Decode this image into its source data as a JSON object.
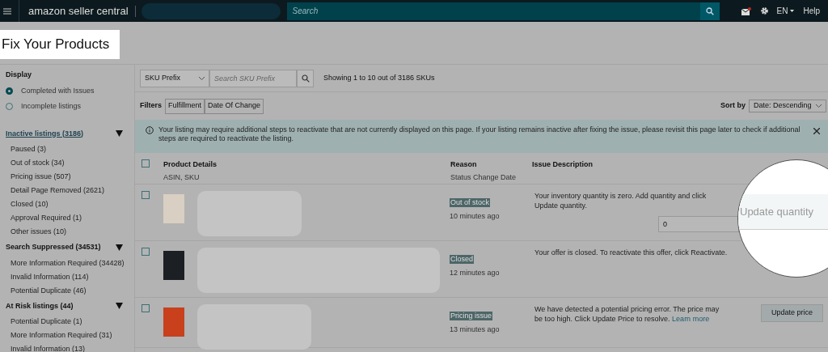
{
  "header": {
    "logo": "amazon seller central",
    "search": {
      "placeholder": "Search"
    },
    "language": "EN",
    "help": "Help",
    "mail_badge": true
  },
  "page_title": "Fix Your Products",
  "sidebar": {
    "display_label": "Display",
    "display_options": [
      {
        "label": "Completed with Issues",
        "selected": true
      },
      {
        "label": "Incomplete listings",
        "selected": false
      }
    ],
    "groups": [
      {
        "title": "Inactive listings (3186)",
        "selected": true,
        "expanded": true,
        "items": [
          "Paused (3)",
          "Out of stock (34)",
          "Pricing issue (507)",
          "Detail Page Removed (2621)",
          "Closed (10)",
          "Approval Required (1)",
          "Other issues (10)"
        ]
      },
      {
        "title": "Search Suppressed (34531)",
        "selected": false,
        "expanded": true,
        "items": [
          "More Information Required (34428)",
          "Invalid Information (114)",
          "Potential Duplicate (46)"
        ]
      },
      {
        "title": "At Risk listings (44)",
        "selected": false,
        "expanded": true,
        "items": [
          "Potential Duplicate (1)",
          "More Information Required (31)",
          "Invalid Information (13)"
        ]
      }
    ]
  },
  "toolbar": {
    "search_type": "SKU Prefix",
    "search": {
      "placeholder": "Search SKU Prefix"
    },
    "showing": "Showing 1 to 10 out of 3186 SKUs",
    "filters_label": "Filters",
    "filters": [
      "Fulfillment",
      "Date Of Change"
    ],
    "sort_label": "Sort by",
    "sort_value": "Date: Descending"
  },
  "banner": "Your listing may require additional steps to reactivate that are not currently displayed on this page. If your listing remains inactive after fixing the issue, please revisit this page later to check if additional steps are required to reactivate the listing.",
  "table": {
    "select_all_checked": false,
    "columns": [
      {
        "title": "Product Details",
        "subtitle": "ASIN, SKU"
      },
      {
        "title": "Reason",
        "subtitle": "Status Change Date"
      },
      {
        "title": "Issue Description"
      }
    ],
    "rows": [
      {
        "checked": false,
        "reason": "Out of stock",
        "time": "10 minutes ago",
        "description": "Your inventory quantity is zero. Add quantity and click Update quantity.",
        "kind": "quantity",
        "quantity": "0"
      },
      {
        "checked": false,
        "reason": "Closed",
        "time": "12 minutes ago",
        "description": "Your offer is closed. To reactivate this offer, click Reactivate.",
        "kind": "none"
      },
      {
        "checked": false,
        "reason": "Pricing issue",
        "time": "13 minutes ago",
        "description": "We have detected a potential pricing error. The price may be too high. Click Update Price to resolve.",
        "link": "Learn more",
        "kind": "button",
        "button": "Update price"
      }
    ]
  },
  "magnifier": {
    "label": "Update quantity"
  }
}
